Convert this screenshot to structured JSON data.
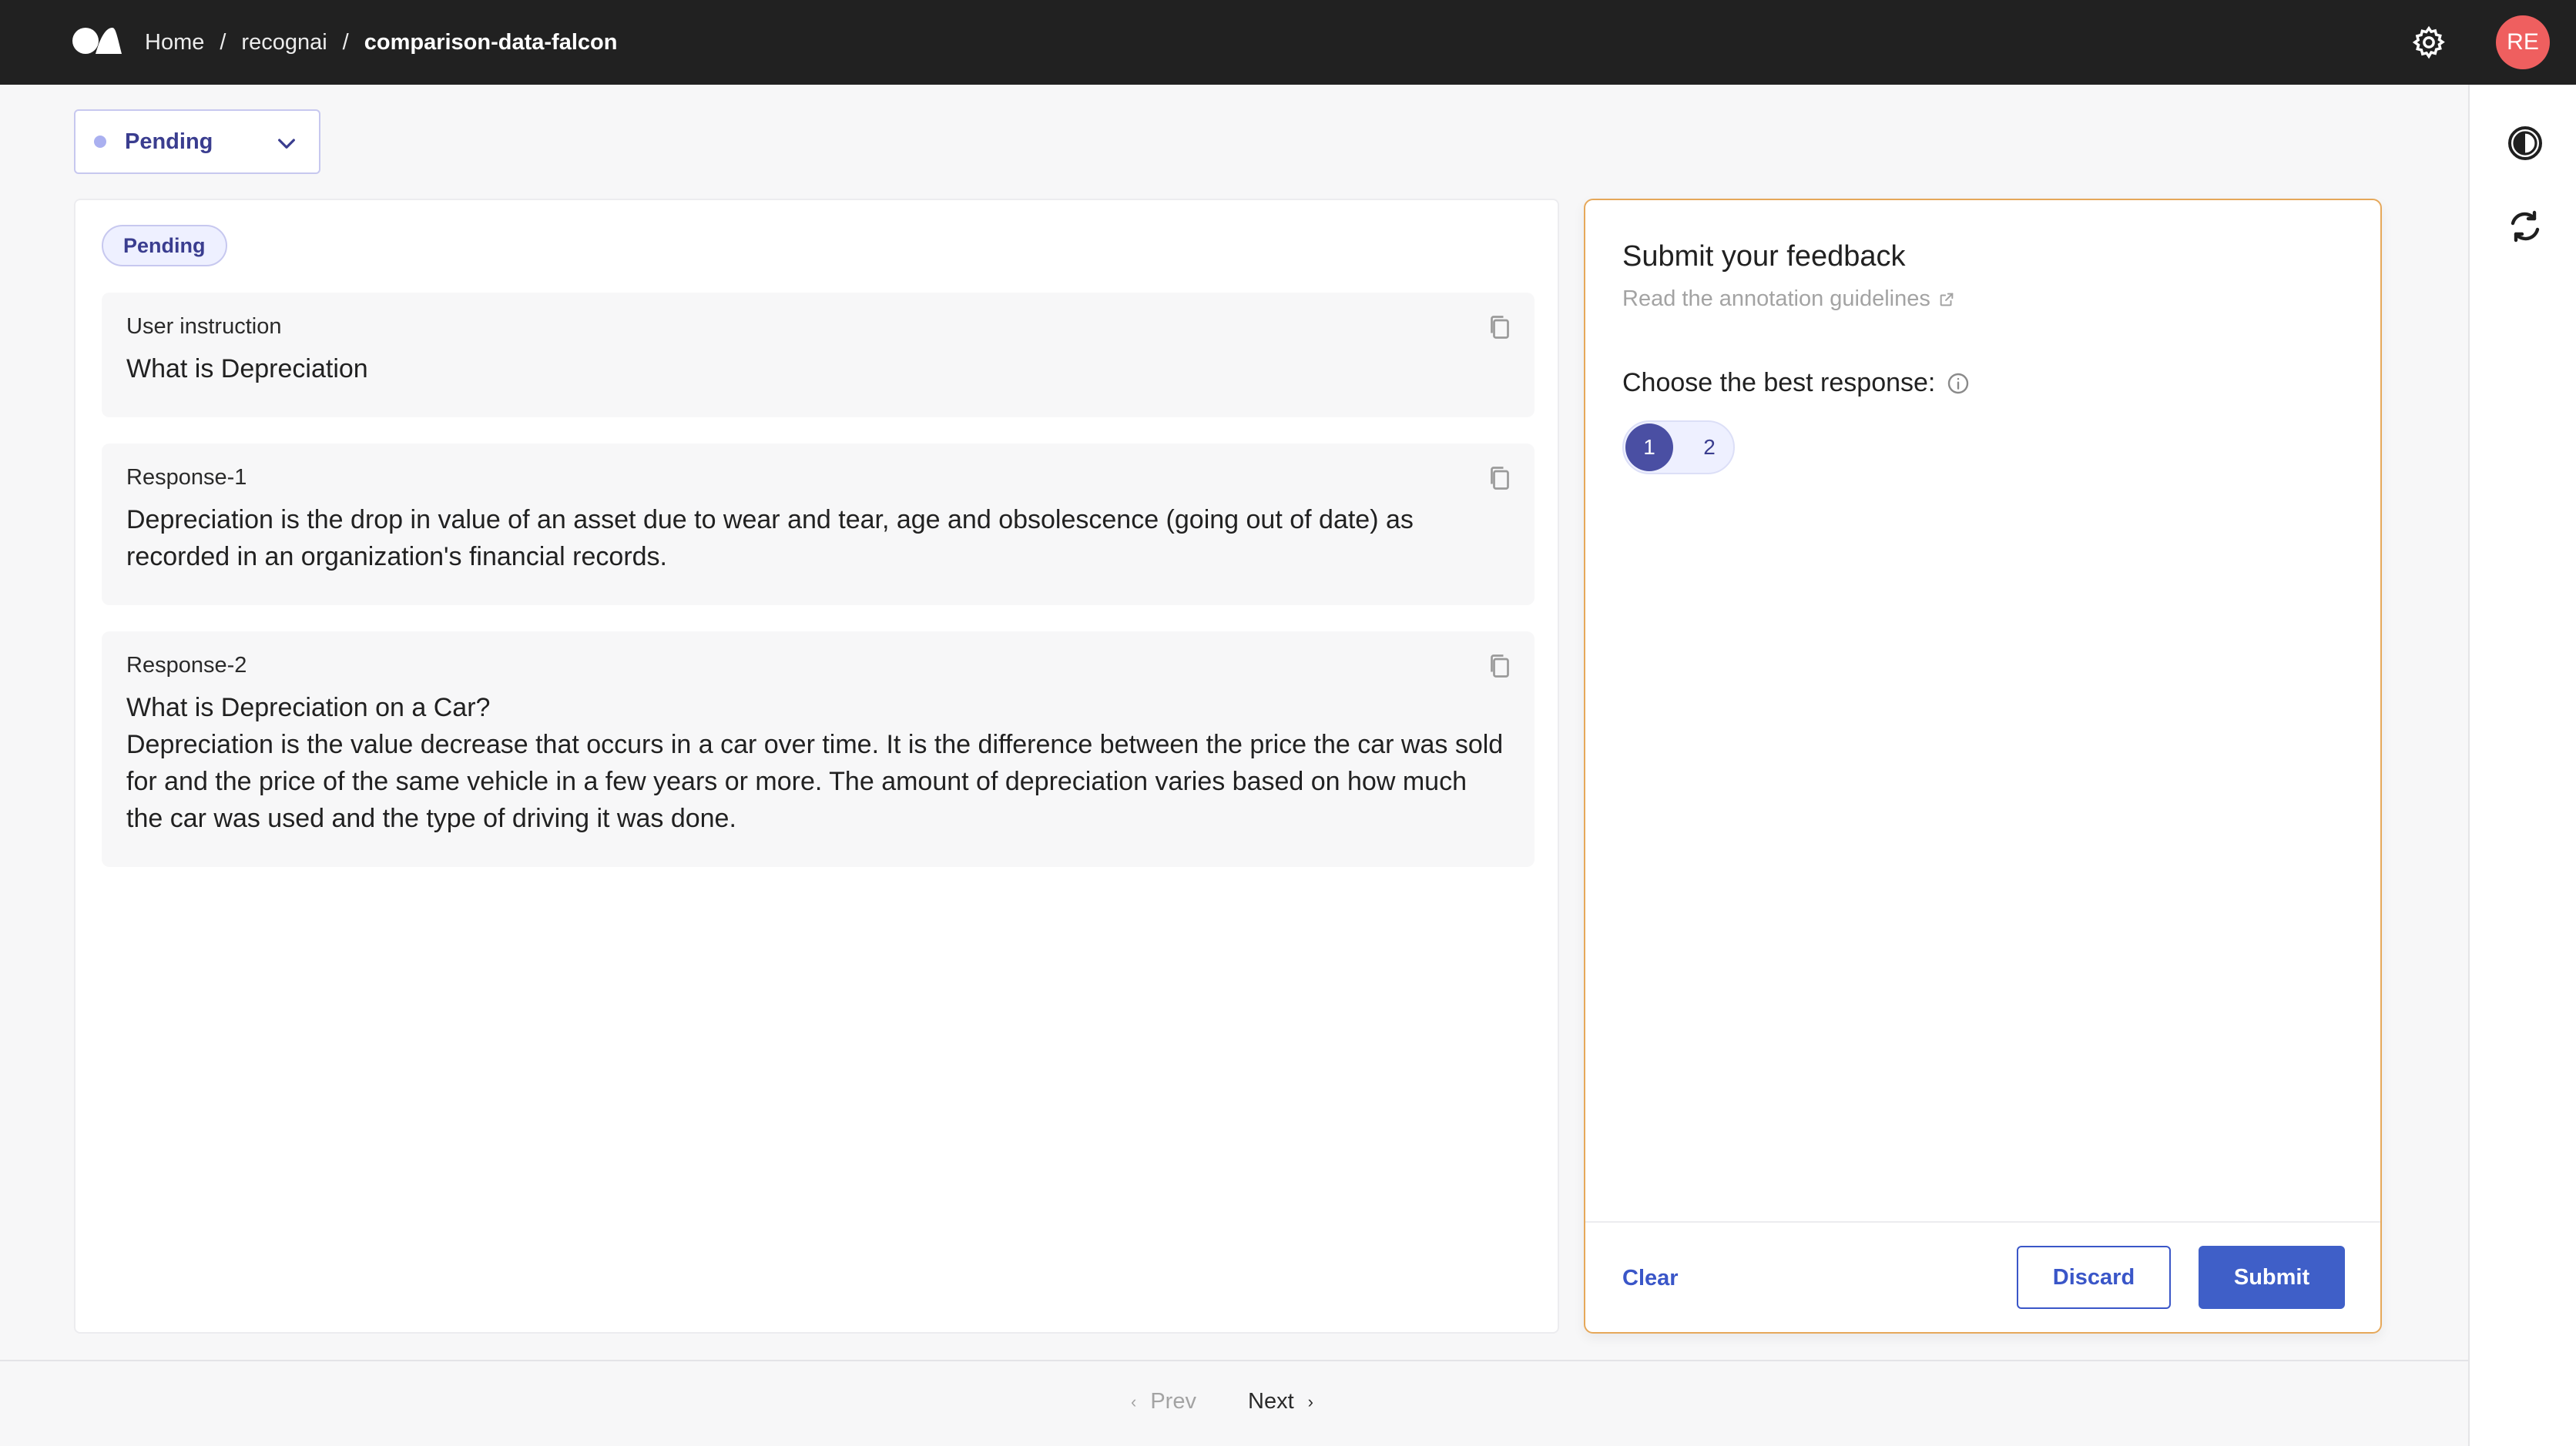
{
  "breadcrumb": {
    "home": "Home",
    "workspace": "recognai",
    "dataset": "comparison-data-falcon",
    "separator": "/"
  },
  "user": {
    "initials": "RE",
    "avatar_color": "#ef5f5f"
  },
  "status_filter": {
    "selected": "Pending"
  },
  "record": {
    "status_badge": "Pending",
    "fields": [
      {
        "title": "User instruction",
        "text": "What is Depreciation"
      },
      {
        "title": "Response-1",
        "text": "Depreciation is the drop in value of an asset due to wear and tear, age and obsolescence (going out of date) as recorded in an organization's financial records."
      },
      {
        "title": "Response-2",
        "text": "What is Depreciation on a Car?\nDepreciation is the value decrease that occurs in a car over time. It is the difference between the price the car was sold for and the price of the same vehicle in a few years or more. The amount of depreciation varies based on how much the car was used and the type of driving it was done."
      }
    ]
  },
  "feedback": {
    "title": "Submit your feedback",
    "guidelines_link": "Read the annotation guidelines",
    "question": "Choose the best response:",
    "options": [
      "1",
      "2"
    ],
    "selected_option": "1",
    "clear_label": "Clear",
    "discard_label": "Discard",
    "submit_label": "Submit",
    "accent_color": "#3f5fc8",
    "panel_border_color": "#e6a85a"
  },
  "pagination": {
    "prev_label": "Prev",
    "next_label": "Next"
  },
  "icons": {
    "logo": "argilla-logo-icon",
    "settings": "gear-icon",
    "theme": "contrast-icon",
    "refresh": "refresh-icon",
    "copy": "copy-icon",
    "info": "info-icon",
    "external": "external-link-icon"
  }
}
